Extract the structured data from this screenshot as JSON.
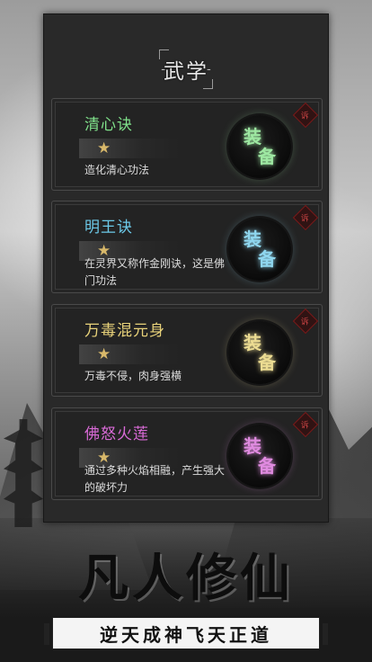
{
  "header": {
    "title_left": "-",
    "title": "武学",
    "title_right": "-"
  },
  "skills": [
    {
      "name": "清心诀",
      "name_color": "#7fe08a",
      "stars": "★",
      "desc": "造化清心功法",
      "equip_1": "装",
      "equip_2": "备",
      "equip_color": "#9ee8a2",
      "badge": "诉"
    },
    {
      "name": "明王诀",
      "name_color": "#6cc9e8",
      "stars": "★",
      "desc": "在灵界又称作金刚诀，这是佛门功法",
      "equip_1": "装",
      "equip_2": "备",
      "equip_color": "#8fd7ef",
      "badge": "诉"
    },
    {
      "name": "万毒混元身",
      "name_color": "#e8d27a",
      "stars": "★",
      "desc": "万毒不侵，肉身强横",
      "equip_1": "装",
      "equip_2": "备",
      "equip_color": "#ecdc92",
      "badge": "诉"
    },
    {
      "name": "佛怒火莲",
      "name_color": "#d86ad6",
      "stars": "★",
      "desc": "通过多种火焰相融，产生强大的破坏力",
      "equip_1": "装",
      "equip_2": "备",
      "equip_color": "#e08be0",
      "badge": "诉"
    }
  ],
  "footer": {
    "brand": "凡人修仙",
    "slogan": "逆天成神飞天正道"
  }
}
